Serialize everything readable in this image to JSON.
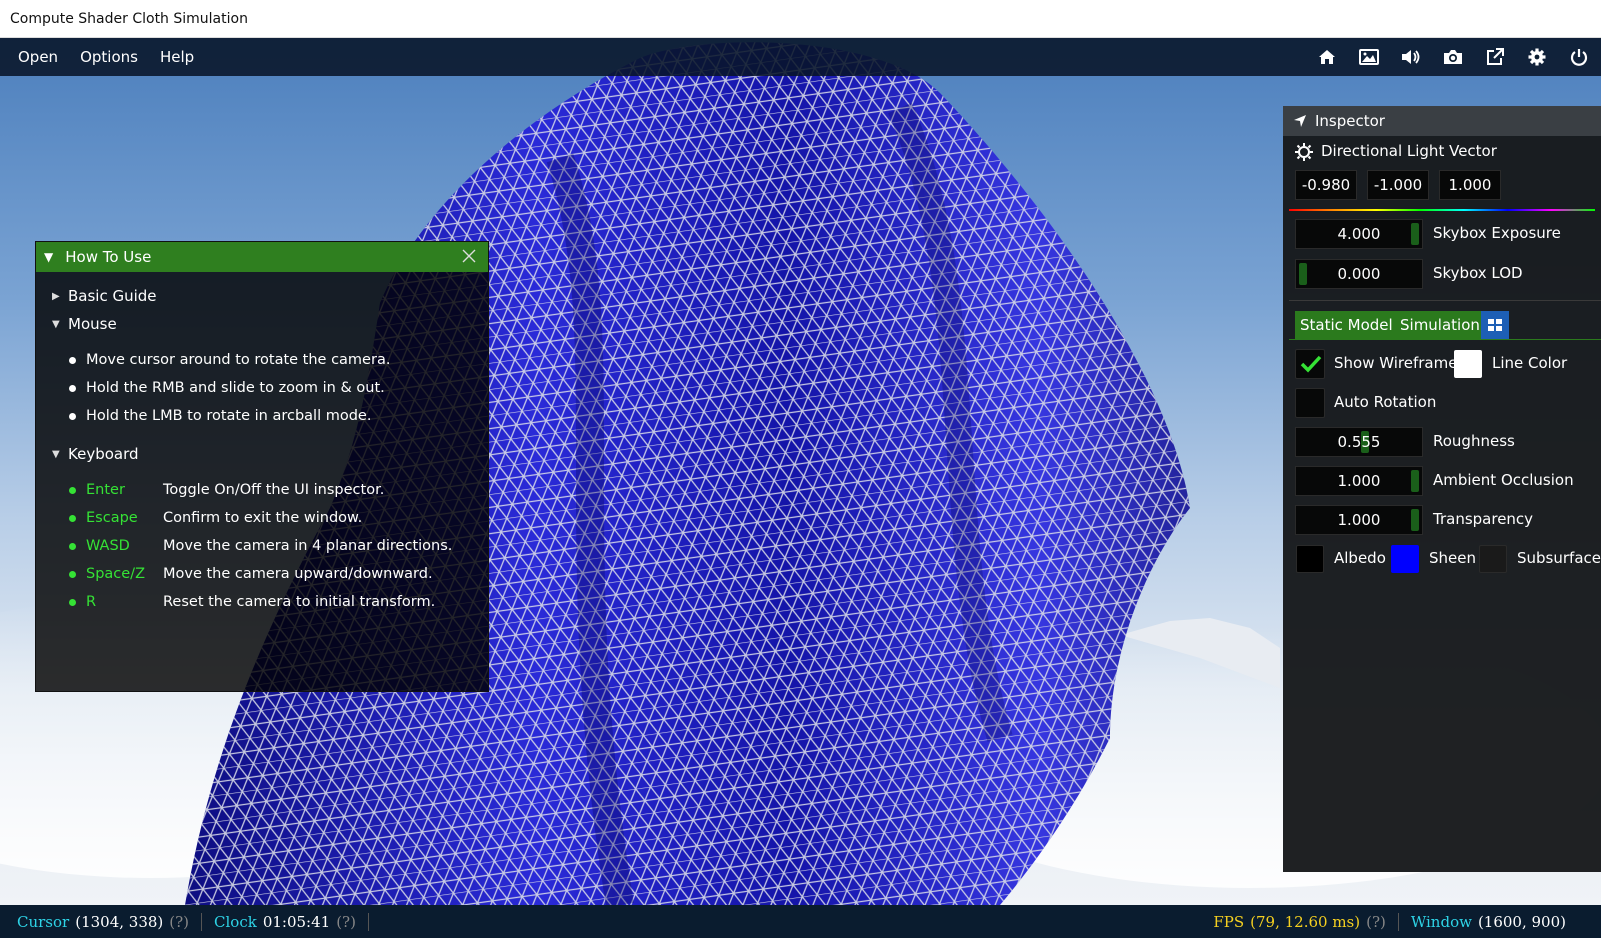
{
  "window": {
    "title": "Compute Shader Cloth Simulation"
  },
  "menu": {
    "items": [
      "Open",
      "Options",
      "Help"
    ]
  },
  "toolbar": {
    "icons": [
      "home-icon",
      "image-icon",
      "speaker-icon",
      "camera-icon",
      "external-link-icon",
      "gear-icon",
      "power-icon"
    ]
  },
  "howto": {
    "title": "How To Use",
    "sections": {
      "basic": "Basic Guide",
      "mouse": "Mouse",
      "keyboard": "Keyboard"
    },
    "mouse_items": [
      "Move cursor around to rotate the camera.",
      "Hold the RMB and slide to zoom in & out.",
      "Hold the LMB to rotate in arcball mode."
    ],
    "keys": [
      {
        "key": "Enter",
        "desc": "Toggle On/Off the UI inspector."
      },
      {
        "key": "Escape",
        "desc": "Confirm to exit the window."
      },
      {
        "key": "WASD",
        "desc": "Move the camera in 4 planar directions."
      },
      {
        "key": "Space/Z",
        "desc": "Move the camera upward/downward."
      },
      {
        "key": "R",
        "desc": "Reset the camera to initial transform."
      }
    ]
  },
  "inspector": {
    "title": "Inspector",
    "light": {
      "label": "Directional Light Vector",
      "x": "-0.980",
      "y": "-1.000",
      "z": "1.000"
    },
    "skybox_exposure": {
      "value": "4.000",
      "label": "Skybox Exposure",
      "fill": 1.0
    },
    "skybox_lod": {
      "value": "0.000",
      "label": "Skybox LOD",
      "fill": 0.0
    },
    "tabs": [
      "Static Model",
      "Simulation"
    ],
    "show_wireframe": {
      "label": "Show Wireframe",
      "checked": true
    },
    "line_color": {
      "label": "Line Color",
      "color": "#ffffff"
    },
    "auto_rotation": {
      "label": "Auto Rotation",
      "checked": false
    },
    "roughness": {
      "value": "0.555",
      "label": "Roughness",
      "fill": 0.555
    },
    "ambient_occlusion": {
      "value": "1.000",
      "label": "Ambient Occlusion",
      "fill": 1.0
    },
    "transparency": {
      "value": "1.000",
      "label": "Transparency",
      "fill": 1.0
    },
    "albedo": {
      "label": "Albedo",
      "color": "#000000"
    },
    "sheen": {
      "label": "Sheen",
      "color": "#0000ff"
    },
    "subsurface": {
      "label": "Subsurface",
      "color": "#1a1a1a"
    }
  },
  "status": {
    "cursor_label": "Cursor",
    "cursor_value": "(1304, 338)",
    "clock_label": "Clock",
    "clock_value": "01:05:41",
    "fps_label": "FPS",
    "fps_value": "(79, 12.60 ms)",
    "window_label": "Window",
    "window_value": "(1600, 900)",
    "help_mark": "(?)"
  },
  "colors": {
    "accent_green": "#2f7f1f",
    "key_green": "#35e235",
    "cloth_blue": "#1a1ab8",
    "status_cyan": "#2ed3e6",
    "status_yellow": "#f5d020"
  }
}
